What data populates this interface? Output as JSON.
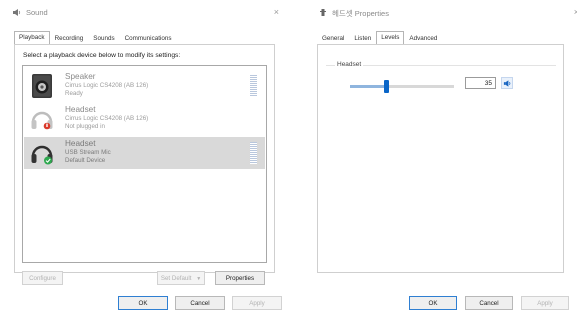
{
  "sound": {
    "title": "Sound",
    "close_glyph": "×",
    "tabs": [
      "Playback",
      "Recording",
      "Sounds",
      "Communications"
    ],
    "instruction": "Select a playback device below to modify its settings:",
    "devices": [
      {
        "name": "Speaker",
        "line1": "Cirrus Logic CS4208 (AB 126)",
        "line2": "Ready",
        "icon": "speaker-icon",
        "status": ""
      },
      {
        "name": "Headset",
        "line1": "Cirrus Logic CS4208 (AB 126)",
        "line2": "Not plugged in",
        "icon": "headset-icon",
        "status": "unplugged"
      },
      {
        "name": "Headset",
        "line1": "USB Stream Mic",
        "line2": "Default Device",
        "icon": "headset-icon",
        "status": "default"
      }
    ],
    "buttons": {
      "configure": "Configure",
      "set_default": "Set Default",
      "set_default_arrow": "▼",
      "properties": "Properties",
      "ok": "OK",
      "cancel": "Cancel",
      "apply": "Apply"
    }
  },
  "properties": {
    "title": "헤드셋 Properties",
    "close_glyph": "×",
    "tabs": [
      "General",
      "Listen",
      "Levels",
      "Advanced"
    ],
    "active_tab": "Levels",
    "levels_group_label": "Headset",
    "volume_value": "35",
    "volume_fraction": 0.35,
    "buttons": {
      "ok": "OK",
      "cancel": "Cancel",
      "apply": "Apply"
    }
  },
  "colors": {
    "accent": "#0a66c8",
    "default_check": "#2fa84f",
    "unplugged_dot": "#d93a2b",
    "selected_row": "#d9d9d9"
  }
}
